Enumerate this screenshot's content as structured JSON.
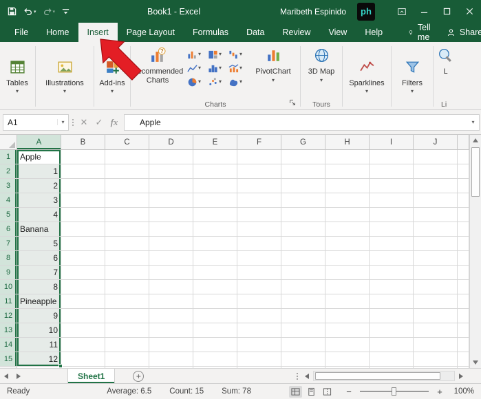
{
  "colors": {
    "excel_green": "#185C37",
    "accent_green": "#217346",
    "arrow_red": "#E31E25"
  },
  "titlebar": {
    "title": "Book1 - Excel",
    "user": "Maribeth Espinido",
    "logo_text": "ph"
  },
  "ribbon_tabs": [
    {
      "label": "File",
      "active": false
    },
    {
      "label": "Home",
      "active": false
    },
    {
      "label": "Insert",
      "active": true
    },
    {
      "label": "Page Layout",
      "active": false
    },
    {
      "label": "Formulas",
      "active": false
    },
    {
      "label": "Data",
      "active": false
    },
    {
      "label": "Review",
      "active": false
    },
    {
      "label": "View",
      "active": false
    },
    {
      "label": "Help",
      "active": false
    }
  ],
  "tell_me_label": "Tell me",
  "share_label": "Share",
  "ribbon": {
    "tables_label": "Tables",
    "illustrations_label": "Illustrations",
    "addins_label": "Add-ins",
    "recommended_charts_label": "Recommended Charts",
    "pivotchart_label": "PivotChart",
    "map3d_label": "3D Map",
    "sparklines_label": "Sparklines",
    "filters_label": "Filters",
    "links_label": "L",
    "chart_buttons": [
      "column-chart",
      "hierarchy-chart",
      "waterfall-chart",
      "line-chart",
      "histogram-chart",
      "combo-chart",
      "pie-chart",
      "scatter-chart",
      "map-chart"
    ],
    "group_labels": {
      "charts": "Charts",
      "tours": "Tours",
      "links": "Li"
    }
  },
  "formula_bar": {
    "name_box": "A1",
    "fx": "fx",
    "formula": "Apple"
  },
  "grid": {
    "columns": [
      "A",
      "B",
      "C",
      "D",
      "E",
      "F",
      "G",
      "H",
      "I",
      "J"
    ],
    "row_count": 16,
    "column_a": [
      "Apple",
      1,
      2,
      3,
      4,
      "Banana",
      5,
      6,
      7,
      8,
      "Pineapple",
      9,
      10,
      11,
      12
    ],
    "selection": {
      "range": "A1:A15",
      "active_cell": "A1"
    }
  },
  "sheet_bar": {
    "tabs": [
      {
        "label": "Sheet1",
        "active": true
      }
    ]
  },
  "status_bar": {
    "mode": "Ready",
    "average": "Average: 6.5",
    "count": "Count: 15",
    "sum": "Sum: 78",
    "zoom_out": "−",
    "zoom_in": "+",
    "zoom": "100%"
  }
}
